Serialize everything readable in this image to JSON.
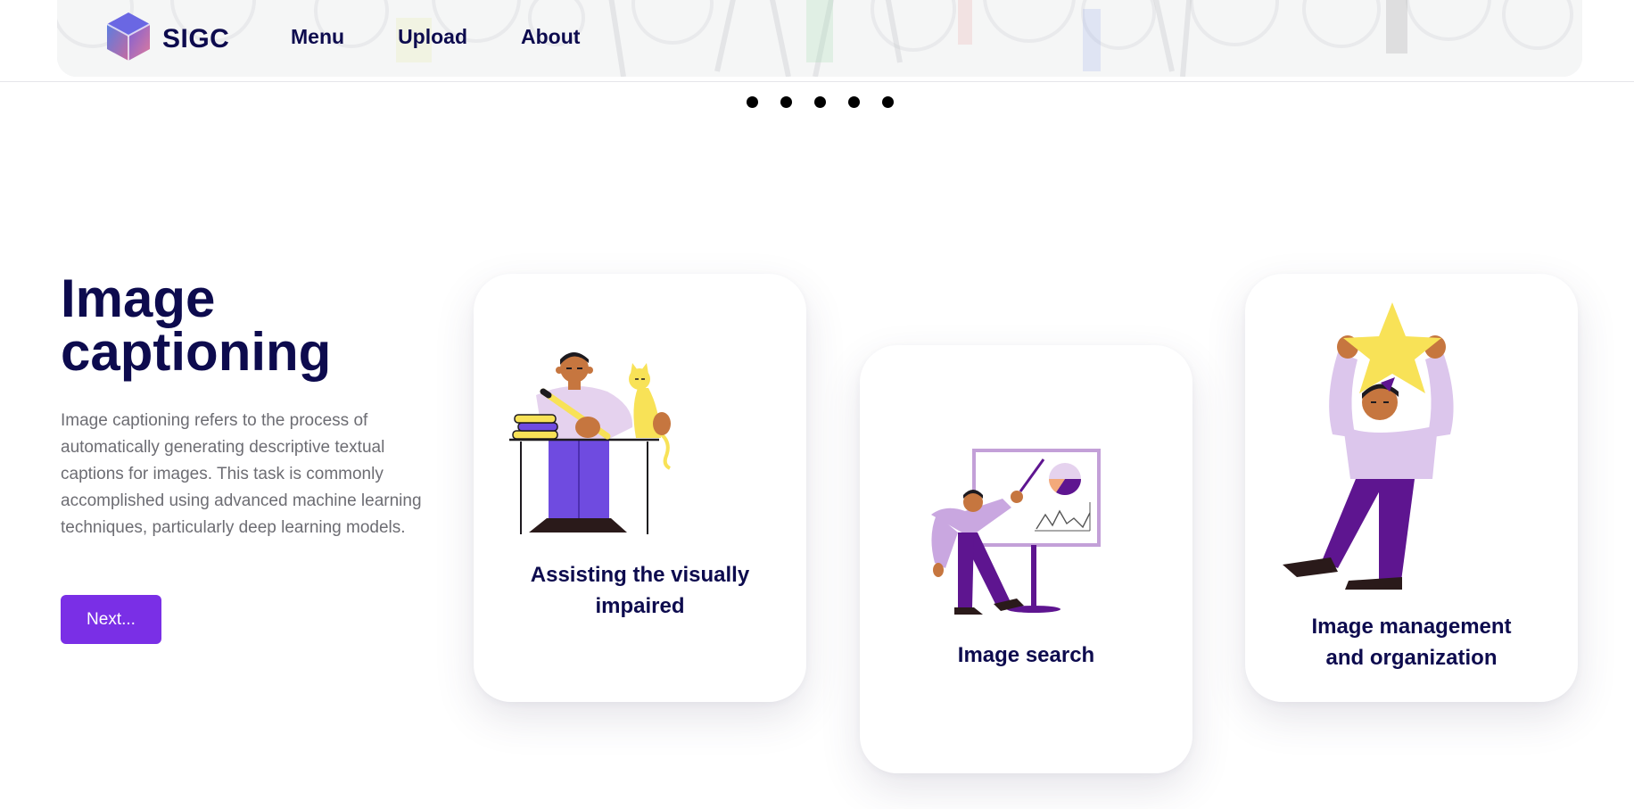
{
  "header": {
    "brand": "SIGC",
    "logo_icon": "cube-logo-icon",
    "nav": [
      {
        "label": "Menu"
      },
      {
        "label": "Upload"
      },
      {
        "label": "About"
      }
    ]
  },
  "carousel": {
    "slide_count": 5
  },
  "intro": {
    "title": "Image captioning",
    "description": "Image captioning refers to the process of automatically generating descriptive textual captions for images. This task is commonly accomplished using advanced machine learning techniques, particularly deep learning models.",
    "next_label": "Next..."
  },
  "cards": [
    {
      "title": "Assisting the visually impaired",
      "icon": "person-writing-with-cat-illustration"
    },
    {
      "title": "Image search",
      "icon": "person-presenting-chart-illustration"
    },
    {
      "title": "Image management and organization",
      "icon": "person-holding-star-illustration"
    }
  ],
  "colors": {
    "primary_text": "#0d0b4e",
    "accent": "#7a2fe6",
    "body_text": "#6d6d73",
    "lavender": "#dcc6ec",
    "purple": "#5e1590",
    "violet": "#6f4be0",
    "yellow": "#f8e257",
    "skin": "#c6763f"
  }
}
